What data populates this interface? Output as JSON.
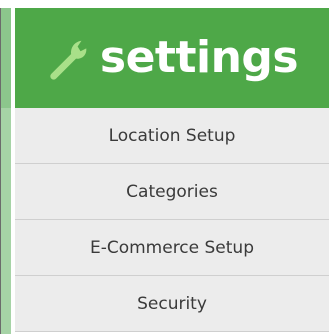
{
  "header": {
    "title": "settings",
    "icon": "wrench-icon",
    "bg_color": "#4ea848",
    "title_color": "#ffffff"
  },
  "menu": {
    "items": [
      {
        "label": "Location Setup"
      },
      {
        "label": "Categories"
      },
      {
        "label": "E-Commerce Setup"
      },
      {
        "label": "Security"
      }
    ]
  }
}
